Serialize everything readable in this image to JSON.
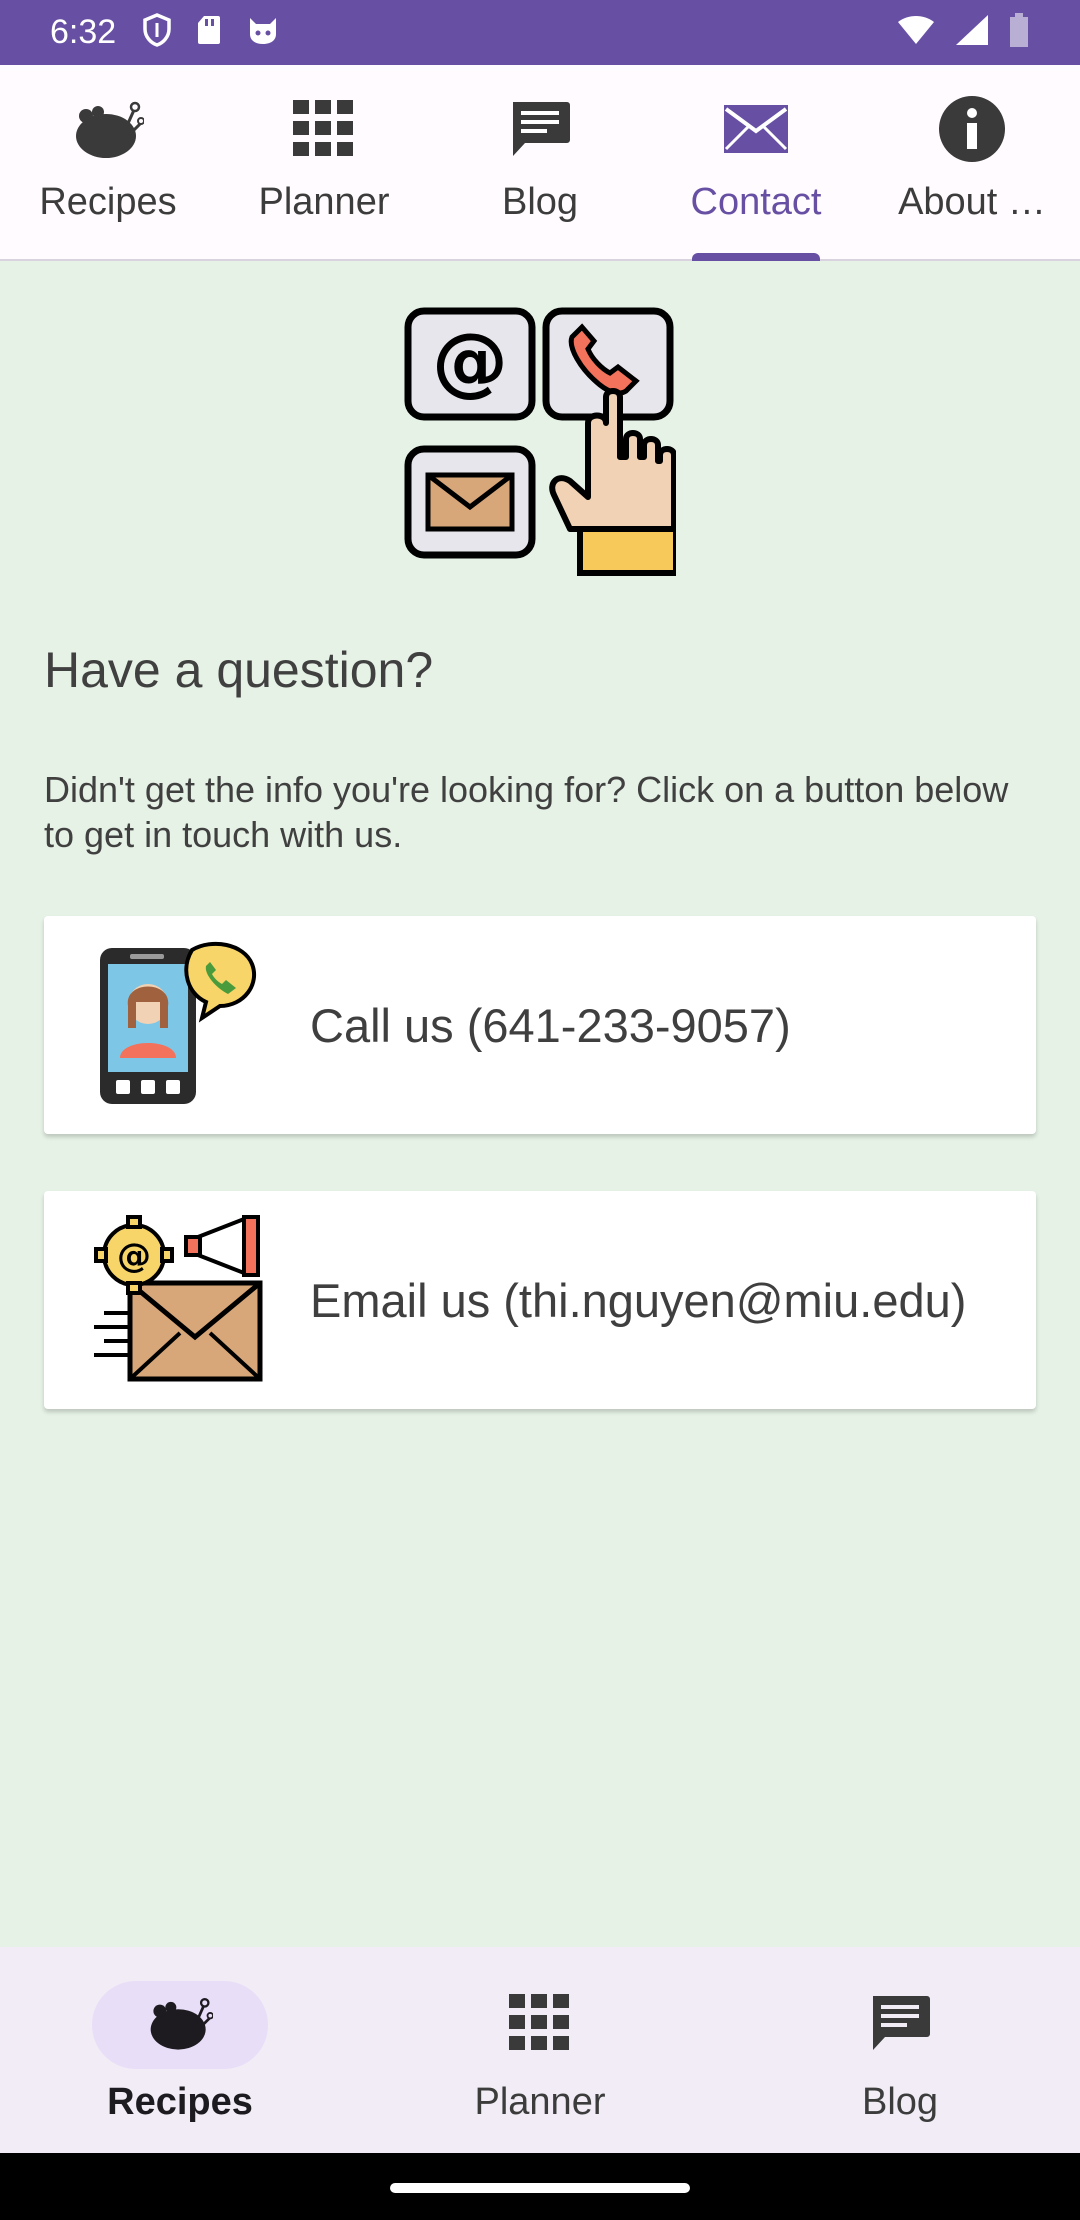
{
  "status_bar": {
    "time": "6:32",
    "icons_left": [
      "shield-icon",
      "sd-card-icon",
      "cat-face-icon"
    ],
    "icons_right": [
      "wifi-icon",
      "signal-icon",
      "battery-icon"
    ],
    "bg_color": "#6750a4"
  },
  "top_tabs": [
    {
      "label": "Recipes",
      "icon": "turkey-icon"
    },
    {
      "label": "Planner",
      "icon": "grid-icon"
    },
    {
      "label": "Blog",
      "icon": "chat-icon"
    },
    {
      "label": "Contact",
      "icon": "mail-icon",
      "active": true
    },
    {
      "label": "About …",
      "icon": "info-icon"
    }
  ],
  "contact": {
    "hero_icon": "contact-methods-icon",
    "heading": "Have a question?",
    "description": "Didn't get the info you're looking for? Click on a button below to get in touch with us.",
    "call_label": "Call us (641-233-9057)",
    "email_label": "Email us (thi.nguyen@miu.edu)"
  },
  "bottom_nav": [
    {
      "label": "Recipes",
      "icon": "turkey-icon",
      "active": true
    },
    {
      "label": "Planner",
      "icon": "grid-icon"
    },
    {
      "label": "Blog",
      "icon": "chat-icon"
    }
  ],
  "colors": {
    "accent": "#6750a4",
    "background": "#e6f2e6",
    "card": "#ffffff",
    "nav_bg": "#f1ecf5"
  }
}
